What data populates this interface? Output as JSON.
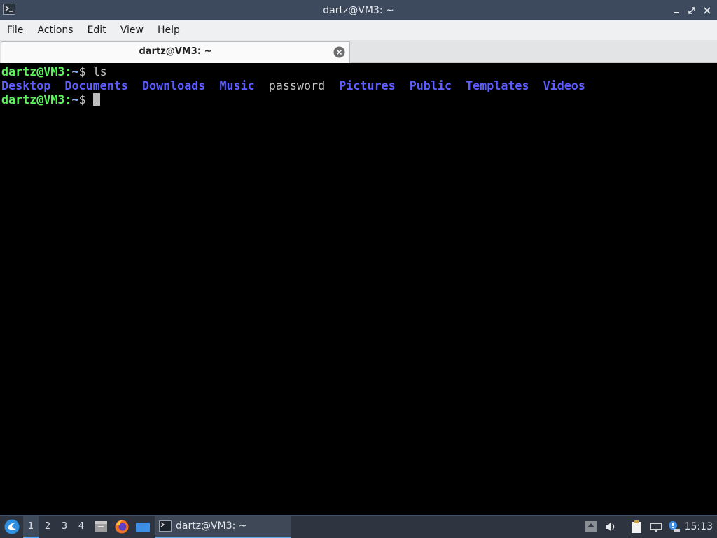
{
  "window": {
    "title": "dartz@VM3: ~"
  },
  "menu": [
    "File",
    "Actions",
    "Edit",
    "View",
    "Help"
  ],
  "tab": {
    "label": "dartz@VM3: ~"
  },
  "terminal": {
    "prompt_user": "dartz@VM3",
    "prompt_colon": ":",
    "prompt_path": "~",
    "prompt_symbol": "$ ",
    "command": "ls",
    "listing": [
      {
        "name": "Desktop",
        "kind": "dir"
      },
      {
        "name": "Documents",
        "kind": "dir"
      },
      {
        "name": "Downloads",
        "kind": "dir"
      },
      {
        "name": "Music",
        "kind": "dir"
      },
      {
        "name": "password",
        "kind": "file"
      },
      {
        "name": "Pictures",
        "kind": "dir"
      },
      {
        "name": "Public",
        "kind": "dir"
      },
      {
        "name": "Templates",
        "kind": "dir"
      },
      {
        "name": "Videos",
        "kind": "dir"
      }
    ],
    "colors": {
      "prompt": "#5ff35f",
      "directory": "#5c5cff",
      "file": "#c6c6c6",
      "background": "#000000"
    }
  },
  "taskbar": {
    "workspaces": [
      "1",
      "2",
      "3",
      "4"
    ],
    "active_workspace": "1",
    "task_label": "dartz@VM3: ~",
    "clock": "15:13",
    "launchers": [
      "file-manager-icon",
      "firefox-icon",
      "desktop-icon"
    ],
    "tray": [
      "upload-icon",
      "volume-icon",
      "clipboard-icon",
      "network-icon",
      "notification-icon"
    ]
  }
}
